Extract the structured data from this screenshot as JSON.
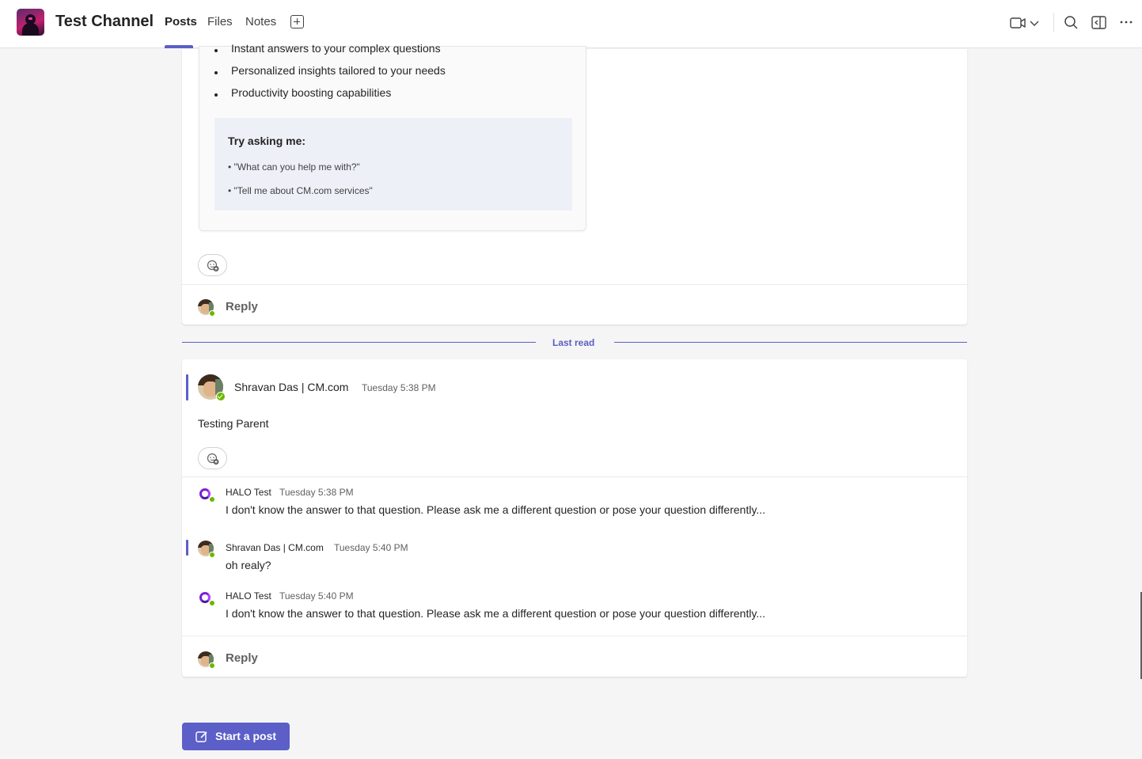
{
  "header": {
    "channel_title": "Test Channel",
    "tabs": [
      {
        "label": "Posts",
        "active": true
      },
      {
        "label": "Files",
        "active": false
      },
      {
        "label": "Notes",
        "active": false
      }
    ],
    "icons": [
      "video-call-icon",
      "chevron-down-icon",
      "search-icon",
      "side-panel-icon",
      "more-options-icon"
    ]
  },
  "bot_card": {
    "bullets": [
      "Instant answers to your complex questions",
      "Personalized insights tailored to your needs",
      "Productivity boosting capabilities"
    ],
    "try_title": "Try asking me:",
    "try_items": [
      "• \"What can you help me with?\"",
      "• \"Tell me about CM.com services\""
    ]
  },
  "reply_label": "Reply",
  "last_read": "Last read",
  "thread": {
    "parent": {
      "author": "Shravan Das | CM.com",
      "time": "Tuesday 5:38 PM",
      "text": "Testing Parent"
    },
    "replies": [
      {
        "author": "HALO Test",
        "time": "Tuesday 5:38 PM",
        "text": "I don't know the answer to that question. Please ask me a different question or pose your question differently..."
      },
      {
        "author": "Shravan Das | CM.com",
        "time": "Tuesday 5:40 PM",
        "text": "oh realy?"
      },
      {
        "author": "HALO Test",
        "time": "Tuesday 5:40 PM",
        "text": "I don't know the answer to that question. Please ask me a different question or pose your question differently..."
      }
    ]
  },
  "start_post_label": "Start a post",
  "colors": {
    "accent": "#5b5fc7",
    "presence_available": "#6bb700",
    "halo_brand": "#7a1fd6"
  }
}
